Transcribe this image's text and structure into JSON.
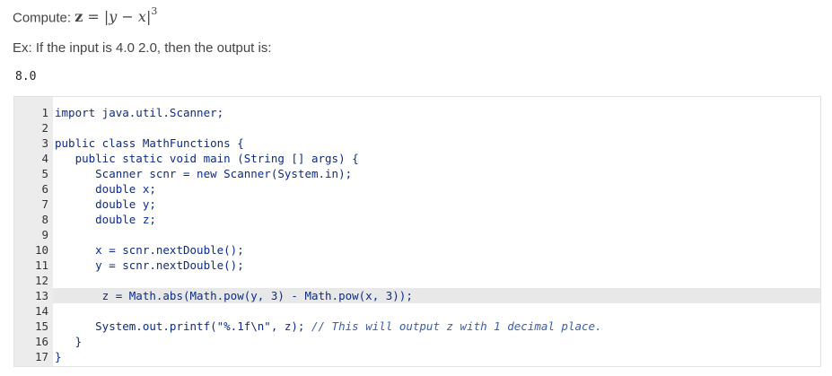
{
  "prompt": {
    "label": "Compute:",
    "lhs": "z",
    "equals": "=",
    "abs_open": "|",
    "expr": "y − x",
    "abs_close": "|",
    "exponent": "3"
  },
  "example": "Ex: If the input is 4.0 2.0, then the output is:",
  "example_output": "8.0",
  "editor": {
    "line_numbers": [
      "1",
      "2",
      "3",
      "4",
      "5",
      "6",
      "7",
      "8",
      "9",
      "10",
      "11",
      "12",
      "13",
      "14",
      "15",
      "16",
      "17"
    ],
    "lines": [
      "import java.util.Scanner;",
      "",
      "public class MathFunctions {",
      "   public static void main (String [] args) {",
      "      Scanner scnr = new Scanner(System.in);",
      "      double x;",
      "      double y;",
      "      double z;",
      "",
      "      x = scnr.nextDouble();",
      "      y = scnr.nextDouble();",
      "",
      "       z = Math.abs(Math.pow(y, 3) - Math.pow(x, 3));",
      "",
      "      System.out.printf(\"%.1f\\n\", z); ",
      "   }",
      "}"
    ],
    "comment_line_15": "// This will output z with 1 decimal place.",
    "active_line": 13
  }
}
